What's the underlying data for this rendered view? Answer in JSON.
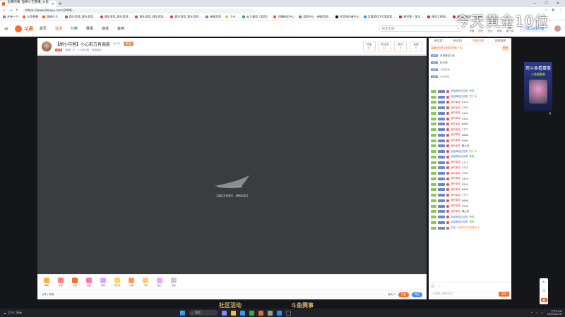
{
  "browser": {
    "tab_title": "比赛的事_强棒小王重播_斗鱼 - ...",
    "url": "https://www.douyu.com/2006...",
    "bookmarks": [
      "开始一下",
      "斗鱼直播",
      "强棒小王...",
      "赛车游戏_赛车游戏...",
      "赛车游戏_赛车游戏...",
      "赛车游戏_赛车游戏...",
      "赛车游戏_赛车游戏...",
      "神棍游戏",
      "飞卡...",
      "云下漫游《游戏》",
      "主播粉丝中心",
      "游戏中心 - 神棍游戏...",
      "抖音创作者中心",
      "比赛游戏 PC版游戏...",
      "建设银 - 版本...",
      "建设互联网...",
      "建设互联网 - 互联网..."
    ]
  },
  "site": {
    "logo_text": "斗鱼",
    "nav": [
      "首页",
      "直播",
      "分类",
      "赛事",
      "游戏",
      "鱼吧"
    ],
    "active_nav": "直播",
    "search_placeholder": "搜索主播",
    "header_icons": [
      {
        "icon": "gear-icon",
        "label": "充值"
      },
      {
        "icon": "history-icon",
        "label": "历史"
      },
      {
        "icon": "star-icon",
        "label": "关注"
      },
      {
        "icon": "bell-icon",
        "label": "消息"
      },
      {
        "icon": "app-icon",
        "label": "客户端"
      }
    ],
    "download_label": "下载斗鱼客户端"
  },
  "banner": {
    "big_text": "今天黄金10位",
    "ad_title": "用斗鱼看赛事",
    "ad_sub": "斗鱼赛事季",
    "bottom_left": "社区活动",
    "bottom_right": "斗鱼赛事"
  },
  "room": {
    "title": "【胡小句爸】小心前方有高能",
    "room_id": "房间号",
    "follow": "关注",
    "level": "LV5",
    "host": "强棒小王",
    "hot": "7546热度",
    "category": "其他娱乐",
    "stats": [
      {
        "label": "热度",
        "value": "47"
      },
      {
        "label": "粉丝团",
        "value": "1人"
      },
      {
        "label": "鱼丸",
        "value": "0"
      },
      {
        "label": "鱼翅",
        "value": "0"
      }
    ],
    "loading_text": "主播正在加载中，请稍后重试",
    "gifts": [
      "弹幕",
      "粉丝",
      "礼物",
      "收藏",
      "成就",
      "荧光棒",
      "火箭",
      "飞机",
      "超火",
      "更多"
    ],
    "footer_left": "分享 | 举报",
    "footer_balance": "鱼丸 0",
    "recharge": "充值",
    "backpack": "背包"
  },
  "chat": {
    "tabs": [
      "贵宾席",
      "粉丝团",
      "贡献日榜",
      "贡献周榜"
    ],
    "active_tab": "贡献日榜",
    "notice": "直播间内禁止刷屏/违规/广告",
    "notice_btn": "房管",
    "top": [
      {
        "badge": "贵宾",
        "text": "我是最强王者"
      },
      {
        "badge": "贵宾",
        "text": "粉丝团"
      },
      {
        "badge": "贵宾",
        "text": "12月5日"
      },
      {
        "badge": "贵宾",
        "text": "400000"
      }
    ],
    "messages": [
      {
        "n": "超级舞蹈狂高歌",
        "t": "来啦",
        "c": "green"
      },
      {
        "n": "超级舞蹈狂高歌",
        "t": "打个卡",
        "c": "green"
      },
      {
        "n": "我的单纯",
        "t": "2222",
        "c": ""
      },
      {
        "n": "我的单纯",
        "t": "3333",
        "c": ""
      },
      {
        "n": "我的单纯",
        "t": "4444",
        "c": ""
      },
      {
        "n": "我的单纯",
        "t": "5555",
        "c": ""
      },
      {
        "n": "我的单纯",
        "t": "6666",
        "c": ""
      },
      {
        "n": "我的单纯",
        "t": "7777",
        "c": ""
      },
      {
        "n": "我的单纯",
        "t": "8888",
        "c": ""
      },
      {
        "n": "我的单纯",
        "t": "9999",
        "c": ""
      },
      {
        "n": "我的单纯",
        "t": "晚上好",
        "c": ""
      },
      {
        "n": "超级舞蹈狂高歌",
        "t": "打个卡",
        "c": "green"
      },
      {
        "n": "超级舞蹈狂高歌",
        "t": "来啦",
        "c": "green"
      },
      {
        "n": "我的单纯",
        "t": "1111",
        "c": ""
      },
      {
        "n": "我的单纯",
        "t": "2222",
        "c": ""
      },
      {
        "n": "我的单纯",
        "t": "3333",
        "c": ""
      },
      {
        "n": "我的单纯",
        "t": "4444",
        "c": ""
      },
      {
        "n": "我的单纯",
        "t": "5555",
        "c": ""
      },
      {
        "n": "我的单纯",
        "t": "6666",
        "c": ""
      },
      {
        "n": "我的单纯",
        "t": "7777",
        "c": ""
      },
      {
        "n": "我的单纯",
        "t": "8888",
        "c": ""
      },
      {
        "n": "我的单纯",
        "t": "9999",
        "c": ""
      },
      {
        "n": "我的单纯",
        "t": "晚上好",
        "c": ""
      },
      {
        "n": "超级舞蹈狂高歌",
        "t": "来啦",
        "c": "green"
      },
      {
        "n": "超级舞蹈狂高歌",
        "t": "来啦",
        "c": "green"
      },
      {
        "n": "欢迎",
        "t": "欢迎来到本直播间 ❤",
        "c": "orange"
      }
    ],
    "input_placeholder": "这里输入聊天内容",
    "send": "发送"
  },
  "taskbar": {
    "weather_temp": "17°C",
    "weather_text": "多云",
    "search_label": "搜索",
    "time": "下午4:06",
    "date": "2025/10/26"
  }
}
